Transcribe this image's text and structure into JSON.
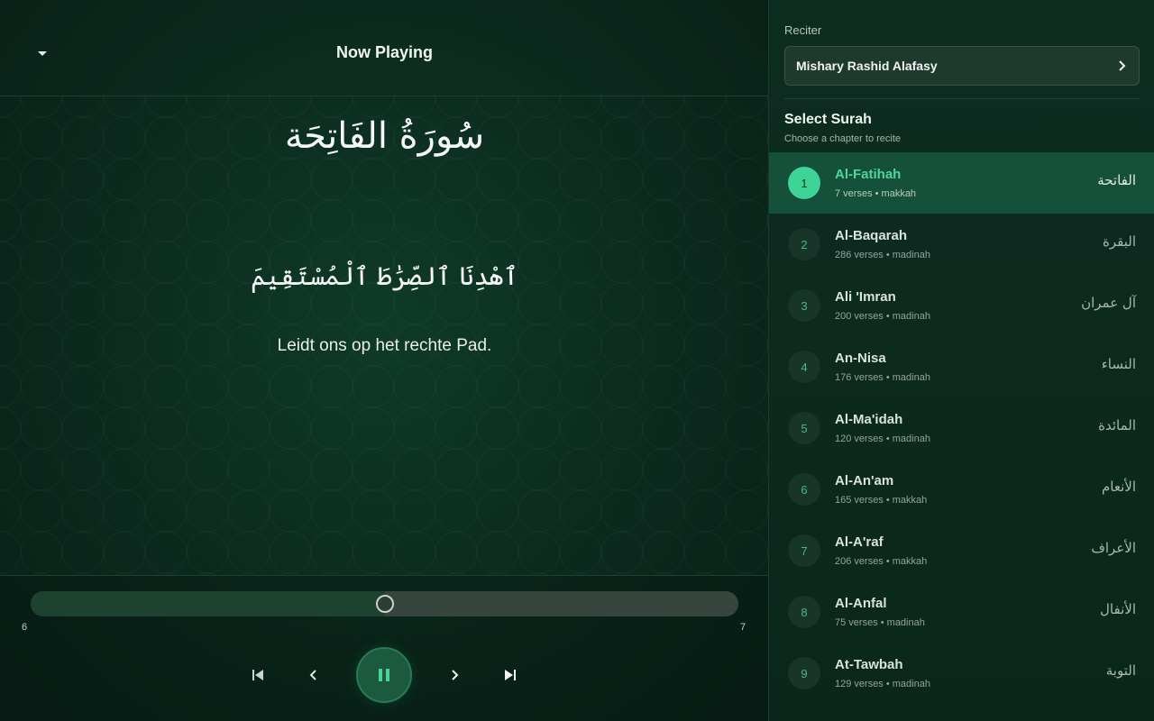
{
  "header": {
    "title": "Now Playing"
  },
  "player": {
    "surah_title_arabic": "سُورَةُ الفَاتِحَة",
    "verse_arabic": "ٱهْدِنَا ٱلصِّرَٰطَ ٱلْمُسْتَقِيمَ",
    "verse_translation": "Leidt ons op het rechte Pad.",
    "progress_fraction": 0.5,
    "range_start": "6",
    "range_end": "7"
  },
  "controls": {
    "first_icon": "skip-previous-icon",
    "prev_icon": "chevron-left-icon",
    "play_icon": "pause-icon",
    "next_icon": "chevron-right-icon",
    "last_icon": "skip-next-icon"
  },
  "sidebar": {
    "reciter_label": "Reciter",
    "reciter_name": "Mishary Rashid Alafasy",
    "select_title": "Select Surah",
    "select_subtitle": "Choose a chapter to recite",
    "surahs": [
      {
        "number": "1",
        "name": "Al-Fatihah",
        "meta": "7 verses • makkah",
        "arabic": "الفاتحة",
        "active": true
      },
      {
        "number": "2",
        "name": "Al-Baqarah",
        "meta": "286 verses • madinah",
        "arabic": "البقرة",
        "active": false
      },
      {
        "number": "3",
        "name": "Ali 'Imran",
        "meta": "200 verses • madinah",
        "arabic": "آل عمران",
        "active": false
      },
      {
        "number": "4",
        "name": "An-Nisa",
        "meta": "176 verses • madinah",
        "arabic": "النساء",
        "active": false
      },
      {
        "number": "5",
        "name": "Al-Ma'idah",
        "meta": "120 verses • madinah",
        "arabic": "المائدة",
        "active": false
      },
      {
        "number": "6",
        "name": "Al-An'am",
        "meta": "165 verses • makkah",
        "arabic": "الأنعام",
        "active": false
      },
      {
        "number": "7",
        "name": "Al-A'raf",
        "meta": "206 verses • makkah",
        "arabic": "الأعراف",
        "active": false
      },
      {
        "number": "8",
        "name": "Al-Anfal",
        "meta": "75 verses • madinah",
        "arabic": "الأنفال",
        "active": false
      },
      {
        "number": "9",
        "name": "At-Tawbah",
        "meta": "129 verses • madinah",
        "arabic": "التوبة",
        "active": false
      }
    ]
  },
  "colors": {
    "accent": "#3ed497",
    "background": "#0b2a1e"
  }
}
